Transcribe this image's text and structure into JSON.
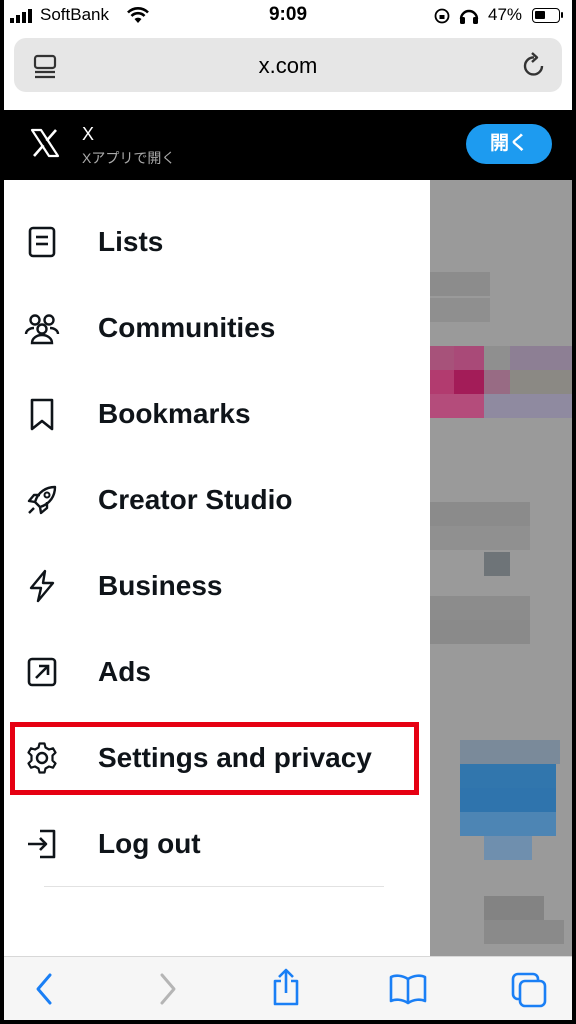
{
  "status_bar": {
    "carrier": "SoftBank",
    "time": "9:09",
    "battery": "47%"
  },
  "browser": {
    "url": "x.com"
  },
  "app_banner": {
    "title": "X",
    "subtitle": "Xアプリで開く",
    "open_label": "開く",
    "accent": "#1d9bf0"
  },
  "menu": {
    "items": [
      {
        "label": "Lists",
        "icon": "list-icon"
      },
      {
        "label": "Communities",
        "icon": "communities-icon"
      },
      {
        "label": "Bookmarks",
        "icon": "bookmark-icon"
      },
      {
        "label": "Creator Studio",
        "icon": "rocket-icon"
      },
      {
        "label": "Business",
        "icon": "lightning-icon"
      },
      {
        "label": "Ads",
        "icon": "ads-arrow-icon"
      },
      {
        "label": "Settings and privacy",
        "icon": "gear-icon"
      },
      {
        "label": "Log out",
        "icon": "logout-icon"
      }
    ],
    "highlight_color": "#e60012"
  },
  "toolbar": {
    "icons": [
      "back-icon",
      "forward-icon",
      "share-icon",
      "bookmarks-book-icon",
      "tabs-icon"
    ]
  }
}
